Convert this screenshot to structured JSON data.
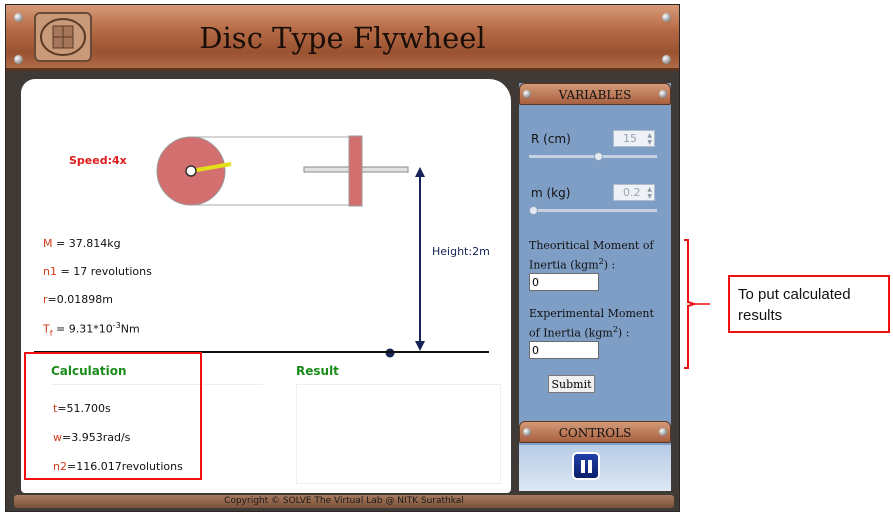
{
  "app": {
    "title": "Disc Type Flywheel",
    "footer": "Copyright © SOLVE The Virtual Lab @ NITK Surathkal"
  },
  "simulation": {
    "speed": "Speed:4x",
    "height_label": "Height:2m",
    "readings": [
      {
        "label": "M",
        "value": " = 37.814kg"
      },
      {
        "label": "n1",
        "value": " = 17 revolutions"
      },
      {
        "label": "r",
        "value": "=0.01898m"
      },
      {
        "label": "T",
        "sub": "f",
        "value": " = 9.31*10",
        "sup": "-3",
        "unit": "Nm"
      }
    ]
  },
  "calculation": {
    "title": "Calculation",
    "lines": [
      {
        "label": "t",
        "value": "=51.700s"
      },
      {
        "label": "w",
        "value": "=3.953rad/s"
      },
      {
        "label": "n2",
        "value": "=116.017revolutions"
      }
    ]
  },
  "result": {
    "title": "Result"
  },
  "variables": {
    "header": "VARIABLES",
    "radius": {
      "label": "R (cm)",
      "value": "15",
      "fraction": 0.55
    },
    "mass": {
      "label": "m (kg)",
      "value": "0.2",
      "fraction": 0.0
    },
    "theoretical": {
      "label_line1": "Theoritical Moment of",
      "label_line2": "Inertia (kgm",
      "sup": "2",
      "suffix": ") :",
      "value": "0"
    },
    "experimental": {
      "label_line1": "Experimental Moment",
      "label_line2": "of Inertia (kgm",
      "sup": "2",
      "suffix": ") :",
      "value": "0"
    },
    "submit": "Submit"
  },
  "controls": {
    "header": "CONTROLS",
    "pause_icon": "pause-icon"
  },
  "annotation": {
    "note": "To put calculated results"
  },
  "colors": {
    "accent_red": "#e11111",
    "label_orange": "#d63a1a",
    "green": "#1a8c1a",
    "panel_blue": "#7f9ec6"
  }
}
